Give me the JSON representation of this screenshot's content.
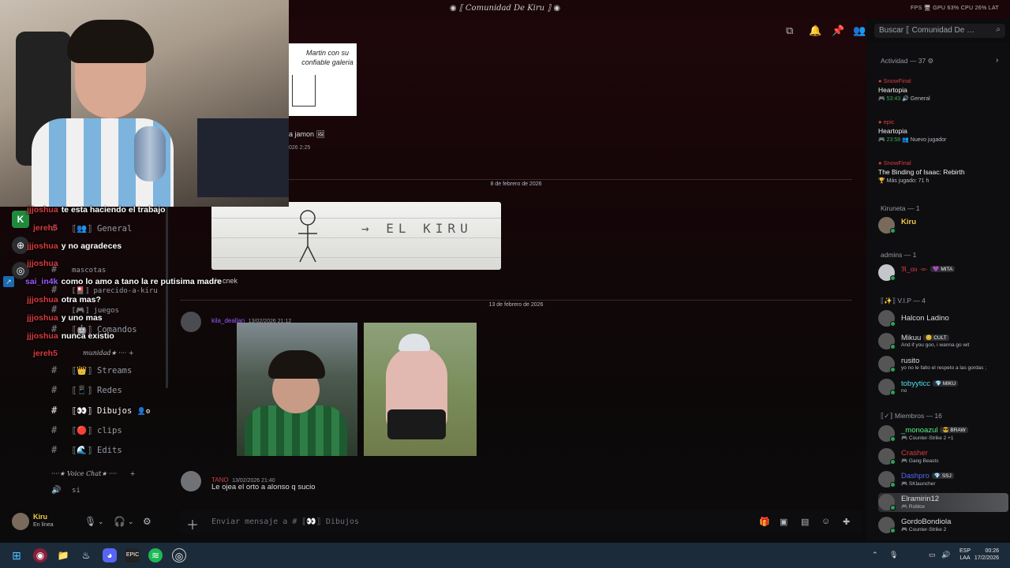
{
  "titlebar": {
    "title": "◉ ⟦ Comunidad De Kiru ⟧ ◉",
    "stats": "FPS 🖥  GPU 63%  CPU 26%  LAT"
  },
  "header": {
    "search_placeholder": "Buscar ⟦ Comunidad De …"
  },
  "chat": {
    "sticker_text": "Martin con su confiable galeria",
    "msg_jamon": "a jamon",
    "msg_time1": "026 2:25",
    "date1": "8 de febrero de 2026",
    "drawing_text": "→ EL KIRU",
    "uncached": "Un cnek",
    "date2": "13 de febrero de 2026",
    "msg2_user": "kila_deallan",
    "msg2_time": "13/02/2026 21:12",
    "msg3_user": "TANO",
    "msg3_time": "13/02/2026 21:40",
    "msg3_text": "Le ojea el orto a alonso q sucio",
    "composer_placeholder": "Enviar mensaje a # ⟦👀⟧ Dibujos"
  },
  "channels": {
    "general": "⟦👥⟧ General",
    "mascotas": "mascotas",
    "parecido": "⟦🎴⟧ parecido-a-kiru",
    "juegos": "⟦🎮⟧ juegos",
    "comandos": "⟦🤖⟧ Comandos",
    "cat_comunidad": "munidad★ ····",
    "streams": "⟦👑⟧ Streams",
    "redes": "⟦📱⟧ Redes",
    "dibujos": "⟦👀⟧ Dibujos",
    "clips": "⟦🔴⟧ clips",
    "edits": "⟦🌊⟧ Edits",
    "cat_voice": "····★ Voice Chat★ ····",
    "voice_si": "si"
  },
  "stream_chat": [
    {
      "name": "jjjoshua",
      "color": "#d83c3e",
      "msg": "te esta haciendo el trabajo"
    },
    {
      "name": "jereh5",
      "color": "#d83c3e",
      "msg": ""
    },
    {
      "name": "jjjoshua",
      "color": "#d83c3e",
      "msg": "y no agradeces"
    },
    {
      "name": "jjjoshua",
      "color": "#d83c3e",
      "msg": ""
    },
    {
      "name": "sai_in4k",
      "color": "#9b59ff",
      "msg": "como lo amo a tano la re putisima madre"
    },
    {
      "name": "jjjoshua",
      "color": "#d83c3e",
      "msg": "otra mas?"
    },
    {
      "name": "jjjoshua",
      "color": "#d83c3e",
      "msg": "y uno mas"
    },
    {
      "name": "jjjoshua",
      "color": "#d83c3e",
      "msg": "nunca existio"
    },
    {
      "name": "jereh5",
      "color": "#d83c3e",
      "msg": ""
    }
  ],
  "user_panel": {
    "name": "Kiru",
    "status": "En línea"
  },
  "right_panel": {
    "activity_header": "Actividad — 37 ⚙",
    "activities": [
      {
        "who": "SnowFinal",
        "game": "Heartopia",
        "meta": "53:43",
        "extra": "🔊 General"
      },
      {
        "who": "epic",
        "game": "Heartopia",
        "meta": "23:58",
        "extra": "👥 Nuevo jugador"
      },
      {
        "who": "SnowFinal",
        "game": "The Binding of Isaac: Rebirth",
        "meta": "",
        "extra": "🏆 Más jugado: 71 h"
      }
    ],
    "kiruneta_header": "Kiruneta — 1",
    "kiru_name": "Kiru",
    "admins_header": "admins — 1",
    "admin_name": "ℜ_αιι ·∞·",
    "admin_tag": "💜 MITA",
    "vip_header": "⟦✨⟧ V.I.P — 4",
    "vip": [
      {
        "name": "Halcon Ladino",
        "color": "#dbdee1",
        "tag": "",
        "sub": ""
      },
      {
        "name": "Mikuu",
        "color": "#dbdee1",
        "tag": "😊 CULT",
        "sub": "And if you goo, i wanna go wit"
      },
      {
        "name": "rusito",
        "color": "#dbdee1",
        "tag": "",
        "sub": "yo no le falto el respeto a las gordas ;"
      },
      {
        "name": "tobyyticc",
        "color": "#4fe3f0",
        "tag": "💎 MIKU",
        "sub": "no"
      }
    ],
    "members_header": "⟦✓⟧ Miembros — 16",
    "members": [
      {
        "name": "_monoazul",
        "color": "#57f287",
        "tag": "😎 BRAW",
        "sub": "🎮 Counter-Strike 2 +1"
      },
      {
        "name": "Crasher",
        "color": "#d83c3e",
        "tag": "",
        "sub": "🎮 Gang Beasts"
      },
      {
        "name": "Dashpro",
        "color": "#5865f2",
        "tag": "💎 SSJ",
        "sub": "🎮 SKlauncher"
      },
      {
        "name": "Elramirin12",
        "color": "#dbdee1",
        "tag": "",
        "sub": "🎮 Roblox"
      },
      {
        "name": "GordoBondiola",
        "color": "#dbdee1",
        "tag": "",
        "sub": "🎮 Counter-Strike 2"
      }
    ]
  },
  "taskbar": {
    "lang1": "ESP",
    "lang2": "LAA",
    "time": "00:26",
    "date": "17/2/2026"
  },
  "colors": {
    "accent": "#5865f2",
    "online": "#23a55a",
    "red_name": "#d83c3e"
  }
}
